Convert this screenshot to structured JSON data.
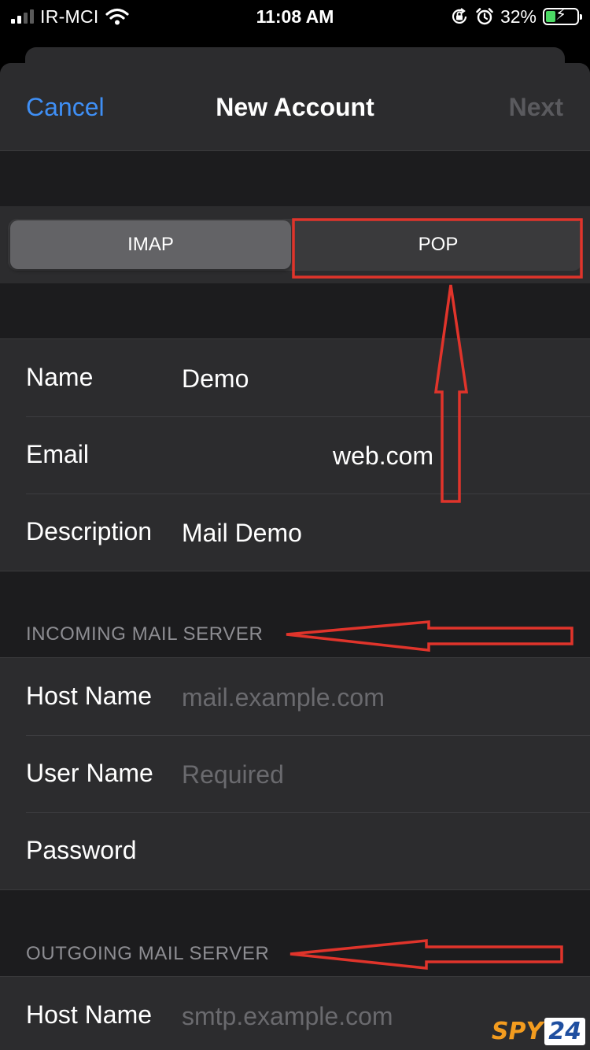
{
  "status_bar": {
    "carrier": "IR-MCI",
    "time": "11:08 AM",
    "battery_percent": "32%",
    "battery_level": 0.32,
    "icons": [
      "signal-icon",
      "wifi-icon",
      "orientation-lock-icon",
      "alarm-icon",
      "battery-charging-icon"
    ]
  },
  "nav": {
    "cancel_label": "Cancel",
    "title": "New Account",
    "next_label": "Next"
  },
  "segmented_control": {
    "options": [
      "IMAP",
      "POP"
    ],
    "selected": "IMAP"
  },
  "account": {
    "rows": [
      {
        "label": "Name",
        "value": "Demo"
      },
      {
        "label": "Email",
        "value": "web.com"
      },
      {
        "label": "Description",
        "value": "Mail Demo"
      }
    ]
  },
  "incoming": {
    "section_title": "INCOMING MAIL SERVER",
    "rows": [
      {
        "label": "Host Name",
        "placeholder": "mail.example.com"
      },
      {
        "label": "User Name",
        "placeholder": "Required"
      },
      {
        "label": "Password",
        "placeholder": ""
      }
    ]
  },
  "outgoing": {
    "section_title": "OUTGOING MAIL SERVER",
    "rows": [
      {
        "label": "Host Name",
        "placeholder": "smtp.example.com"
      }
    ]
  },
  "colors": {
    "accent": "#3f8ff5",
    "annotation": "#e0342b",
    "background": "#1c1c1e",
    "cell": "#2c2c2e"
  },
  "watermark": {
    "brand": "SPY",
    "number": "24"
  }
}
